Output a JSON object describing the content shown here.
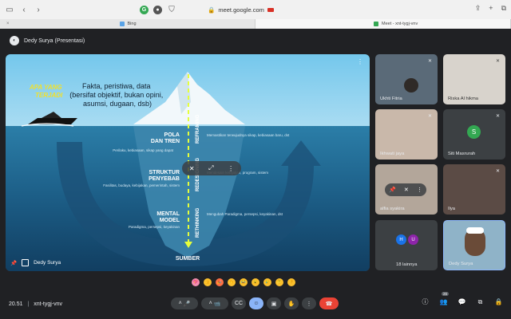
{
  "browser": {
    "url": "meet.google.com",
    "tabs": [
      {
        "label": "Bing",
        "favicon_color": "#5aa3e6"
      },
      {
        "label": "Meet - xnt-tygj-vnv",
        "favicon_color": "#34a853"
      }
    ]
  },
  "meet": {
    "presenter_title": "Dedy Surya (Presentasi)",
    "slide": {
      "heading_left": "APA YANG TERJADI",
      "intro_text_1": "Fakta, peristiwa, data",
      "intro_text_2": "(bersifat objektif, bukan opini,",
      "intro_text_3": "asumsi, dugaan, dsb)",
      "level1_left": "POLA DAN TREN",
      "level1_left_sub": "Perilaku, kebiasaan, sikap yang dapat",
      "level1_mid": "REFRAMING",
      "level1_right": "Memastikan terwujudnya sikap, kebiasaan baru, dst",
      "level2_left": "STRUKTUR PENYEBAB",
      "level2_left_sub": "Fasilitas, budaya, kebijakan, pemerintah, sistem",
      "level2_mid": "REDESIGNING",
      "level2_right": "Mendesain kebijakan, program, sistem",
      "level3_left": "MENTAL MODEL",
      "level3_left_sub": "Paradigma, persepsi, keyakinan",
      "level3_mid": "RETHINKING",
      "level3_right": "Mengubah Paradigma, persepsi, keyakinan, dst",
      "bottom_label": "SUMBER",
      "footer_name": "Dedy Surya"
    },
    "tiles": [
      {
        "name": "Ukhti Fitria"
      },
      {
        "name": "Riska Al hikma"
      },
      {
        "name": "Ikhwati jaya"
      },
      {
        "name": "Siti Masrurah",
        "initial": "S",
        "color": "#33a852"
      },
      {
        "name": "alfia syakira"
      },
      {
        "name": "Ilya"
      },
      {
        "name": "18 lainnya",
        "initial_a": "H",
        "initial_b": "U",
        "color_a": "#1a73e8",
        "color_b": "#8e24aa"
      },
      {
        "name": "Dedy Surya"
      }
    ],
    "clock": "20.51",
    "separator": "|",
    "meeting_code": "xnt-tygj-vnv",
    "participants_count": "26"
  }
}
